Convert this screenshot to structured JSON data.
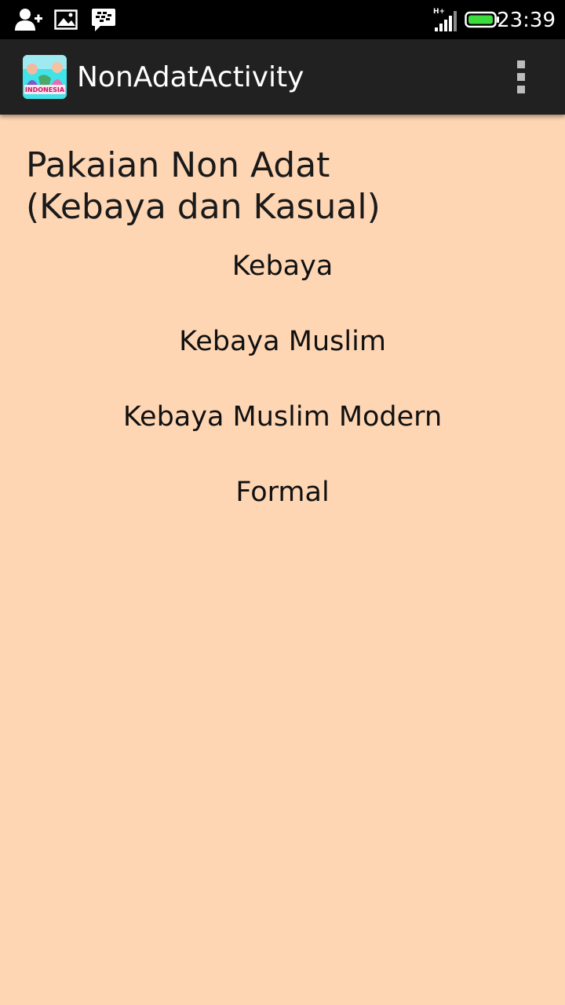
{
  "status_bar": {
    "time": "23:39",
    "network_label": "H+",
    "icons": [
      "add-contact-icon",
      "image-icon",
      "bbm-icon",
      "signal-icon",
      "battery-icon"
    ],
    "battery_color": "#3ddc3d"
  },
  "action_bar": {
    "title": "NonAdatActivity",
    "app_icon_text": "INDONESIA",
    "background": "#212121"
  },
  "page": {
    "background": "#fed6b4",
    "heading_line1": "Pakaian Non Adat",
    "heading_line2": "(Kebaya dan Kasual)",
    "items": [
      {
        "label": "Kebaya"
      },
      {
        "label": "Kebaya Muslim"
      },
      {
        "label": "Kebaya Muslim Modern"
      },
      {
        "label": "Formal"
      }
    ]
  }
}
